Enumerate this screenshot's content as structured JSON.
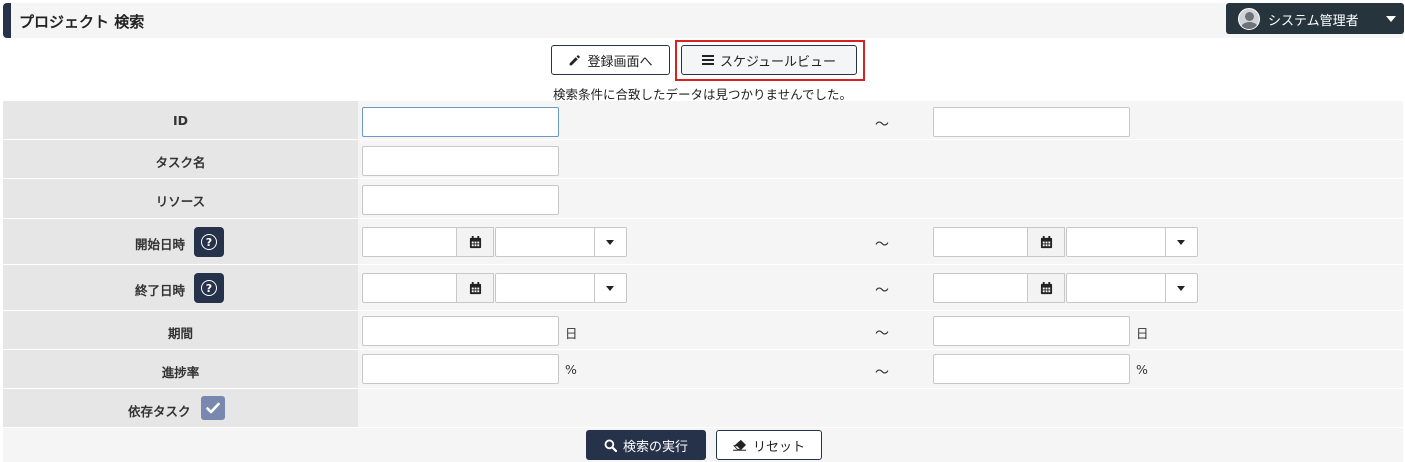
{
  "header": {
    "title": "プロジェクト 検索",
    "user_name": "システム管理者"
  },
  "toolbar": {
    "register_label": "登録画面へ",
    "schedule_label": "スケジュールビュー"
  },
  "message": "検索条件に合致したデータは見つかりませんでした。",
  "form": {
    "tilde": "～",
    "rows": [
      {
        "label": "ID"
      },
      {
        "label": "タスク名"
      },
      {
        "label": "リソース"
      },
      {
        "label": "開始日時"
      },
      {
        "label": "終了日時"
      },
      {
        "label": "期間",
        "unit": "日"
      },
      {
        "label": "進捗率",
        "unit": "%"
      },
      {
        "label": "依存タスク"
      }
    ]
  },
  "actions": {
    "search_label": "検索の実行",
    "reset_label": "リセット"
  },
  "icons": {
    "pencil": "pencil-icon",
    "list": "list-icon",
    "calendar": "calendar-icon",
    "help": "question-circle-icon",
    "check": "check-icon",
    "search": "search-icon",
    "eraser": "eraser-icon",
    "user": "user-avatar-icon"
  },
  "colors": {
    "primary": "#26324a",
    "header_button": "#26343e",
    "highlight": "#d92121",
    "checkbox": "#7a88b0"
  }
}
